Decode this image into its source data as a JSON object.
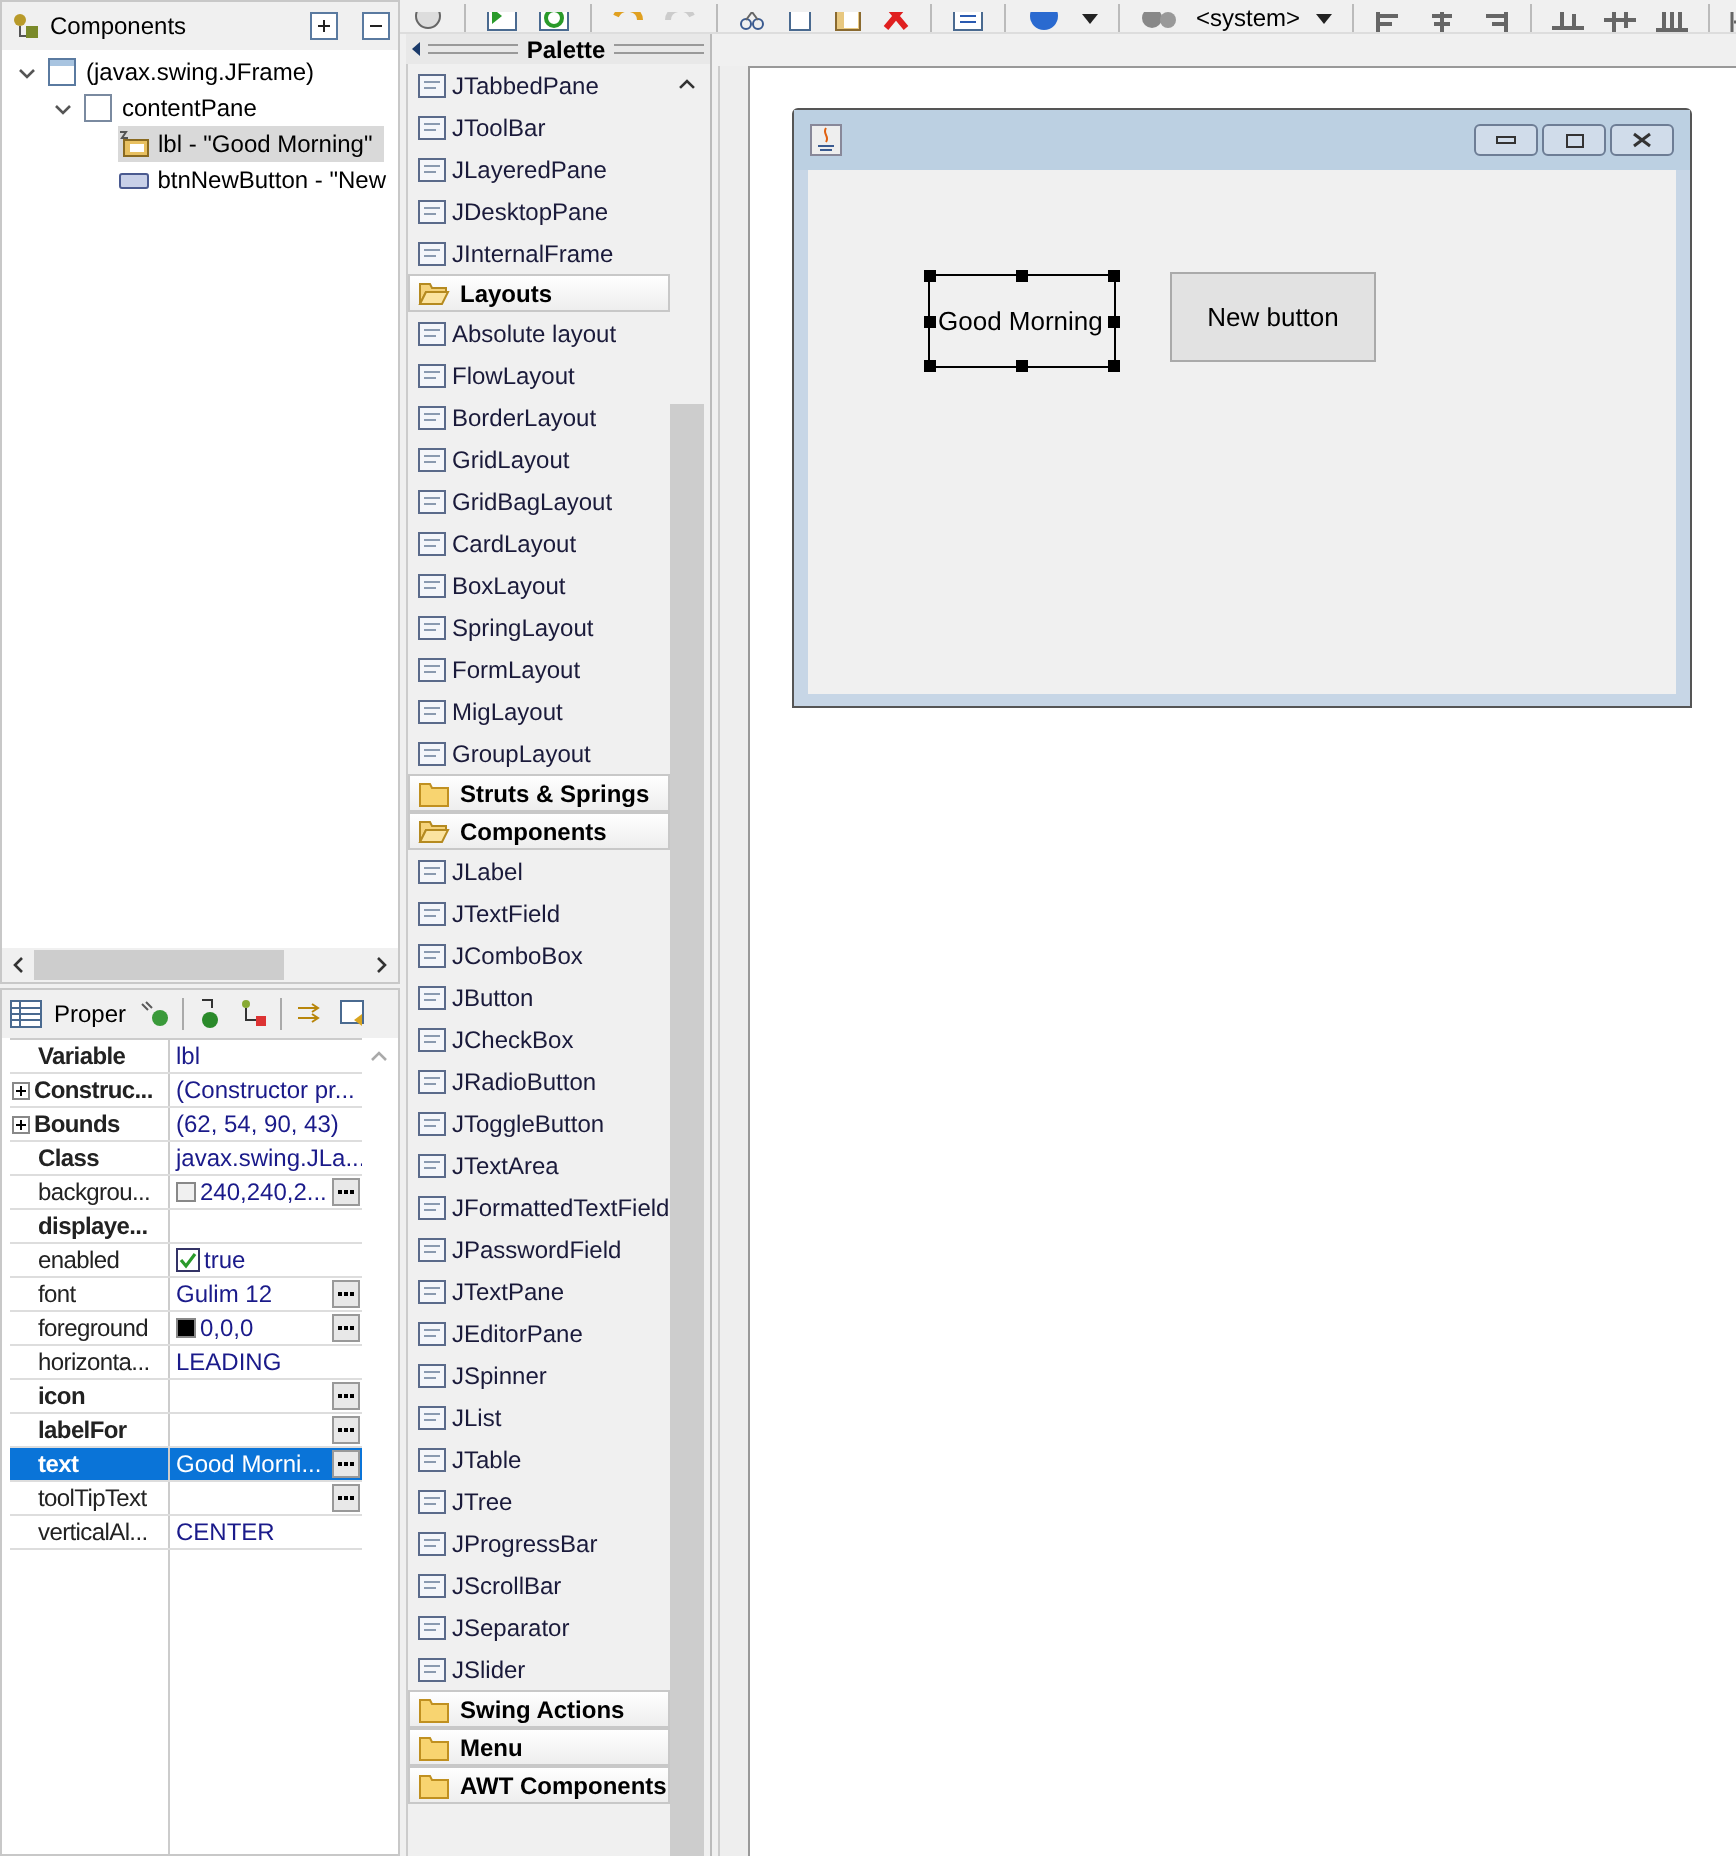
{
  "components_view": {
    "title": "Components",
    "tree": [
      {
        "label": "(javax.swing.JFrame)",
        "kind": "frame",
        "expanded": true,
        "selected": false,
        "children": [
          {
            "label": "contentPane",
            "kind": "panel",
            "expanded": true,
            "selected": false,
            "children": [
              {
                "label": "lbl - \"Good Morning\"",
                "kind": "label",
                "selected": true
              },
              {
                "label": "btnNewButton - \"New",
                "kind": "button",
                "selected": false
              }
            ]
          }
        ]
      }
    ]
  },
  "properties_view": {
    "title": "Proper",
    "rows": [
      {
        "name": "Variable",
        "bold": true,
        "expandable": false,
        "value": "lbl",
        "editor": false,
        "selected": false
      },
      {
        "name": "Construc...",
        "bold": true,
        "expandable": true,
        "value": "(Constructor pr...",
        "editor": false,
        "selected": false
      },
      {
        "name": "Bounds",
        "bold": true,
        "expandable": true,
        "value": "(62, 54, 90, 43)",
        "editor": false,
        "selected": false
      },
      {
        "name": "Class",
        "bold": true,
        "expandable": false,
        "value": "javax.swing.JLa...",
        "editor": false,
        "selected": false
      },
      {
        "name": "backgrou...",
        "bold": false,
        "expandable": false,
        "kind": "color",
        "color": "#f0f0f0",
        "value": "240,240,2...",
        "editor": true,
        "selected": false
      },
      {
        "name": "displaye...",
        "bold": true,
        "expandable": false,
        "editor": false,
        "selected": false
      },
      {
        "name": "enabled",
        "bold": false,
        "expandable": false,
        "kind": "checkbox",
        "checked": true,
        "value": "true",
        "editor": false,
        "selected": false
      },
      {
        "name": "font",
        "bold": false,
        "expandable": false,
        "value": "Gulim 12",
        "editor": true,
        "selected": false
      },
      {
        "name": "foreground",
        "bold": false,
        "expandable": false,
        "kind": "color",
        "color": "#000000",
        "value": "0,0,0",
        "editor": true,
        "selected": false
      },
      {
        "name": "horizonta...",
        "bold": false,
        "expandable": false,
        "value": "LEADING",
        "editor": false,
        "selected": false
      },
      {
        "name": "icon",
        "bold": true,
        "expandable": false,
        "editor": true,
        "selected": false
      },
      {
        "name": "labelFor",
        "bold": true,
        "expandable": false,
        "editor": true,
        "selected": false
      },
      {
        "name": "text",
        "bold": true,
        "expandable": false,
        "value": "Good Morni...",
        "editor": true,
        "selected": true
      },
      {
        "name": "toolTipText",
        "bold": false,
        "expandable": false,
        "editor": true,
        "selected": false
      },
      {
        "name": "verticalAl...",
        "bold": false,
        "expandable": false,
        "value": "CENTER",
        "editor": false,
        "selected": false
      }
    ]
  },
  "toolbar": {
    "look_and_feel": "<system>"
  },
  "palette": {
    "title": "Palette",
    "entries": [
      {
        "kind": "item",
        "label": "JTabbedPane"
      },
      {
        "kind": "item",
        "label": "JToolBar"
      },
      {
        "kind": "item",
        "label": "JLayeredPane"
      },
      {
        "kind": "item",
        "label": "JDesktopPane"
      },
      {
        "kind": "item",
        "label": "JInternalFrame"
      },
      {
        "kind": "category",
        "label": "Layouts",
        "expanded": true
      },
      {
        "kind": "item",
        "label": "Absolute layout"
      },
      {
        "kind": "item",
        "label": "FlowLayout"
      },
      {
        "kind": "item",
        "label": "BorderLayout"
      },
      {
        "kind": "item",
        "label": "GridLayout"
      },
      {
        "kind": "item",
        "label": "GridBagLayout"
      },
      {
        "kind": "item",
        "label": "CardLayout"
      },
      {
        "kind": "item",
        "label": "BoxLayout"
      },
      {
        "kind": "item",
        "label": "SpringLayout"
      },
      {
        "kind": "item",
        "label": "FormLayout"
      },
      {
        "kind": "item",
        "label": "MigLayout"
      },
      {
        "kind": "item",
        "label": "GroupLayout"
      },
      {
        "kind": "category",
        "label": "Struts & Springs",
        "expanded": false
      },
      {
        "kind": "category",
        "label": "Components",
        "expanded": true
      },
      {
        "kind": "item",
        "label": "JLabel"
      },
      {
        "kind": "item",
        "label": "JTextField"
      },
      {
        "kind": "item",
        "label": "JComboBox"
      },
      {
        "kind": "item",
        "label": "JButton"
      },
      {
        "kind": "item",
        "label": "JCheckBox"
      },
      {
        "kind": "item",
        "label": "JRadioButton"
      },
      {
        "kind": "item",
        "label": "JToggleButton"
      },
      {
        "kind": "item",
        "label": "JTextArea"
      },
      {
        "kind": "item",
        "label": "JFormattedTextField"
      },
      {
        "kind": "item",
        "label": "JPasswordField"
      },
      {
        "kind": "item",
        "label": "JTextPane"
      },
      {
        "kind": "item",
        "label": "JEditorPane"
      },
      {
        "kind": "item",
        "label": "JSpinner"
      },
      {
        "kind": "item",
        "label": "JList"
      },
      {
        "kind": "item",
        "label": "JTable"
      },
      {
        "kind": "item",
        "label": "JTree"
      },
      {
        "kind": "item",
        "label": "JProgressBar"
      },
      {
        "kind": "item",
        "label": "JScrollBar"
      },
      {
        "kind": "item",
        "label": "JSeparator"
      },
      {
        "kind": "item",
        "label": "JSlider"
      },
      {
        "kind": "category",
        "label": "Swing Actions",
        "expanded": false
      },
      {
        "kind": "category",
        "label": "Menu",
        "expanded": false
      },
      {
        "kind": "category",
        "label": "AWT Components",
        "expanded": false
      }
    ]
  },
  "design": {
    "widgets": [
      {
        "kind": "label",
        "text": "Good Morning",
        "selected": true
      },
      {
        "kind": "button",
        "text": "New button",
        "selected": false
      }
    ]
  }
}
